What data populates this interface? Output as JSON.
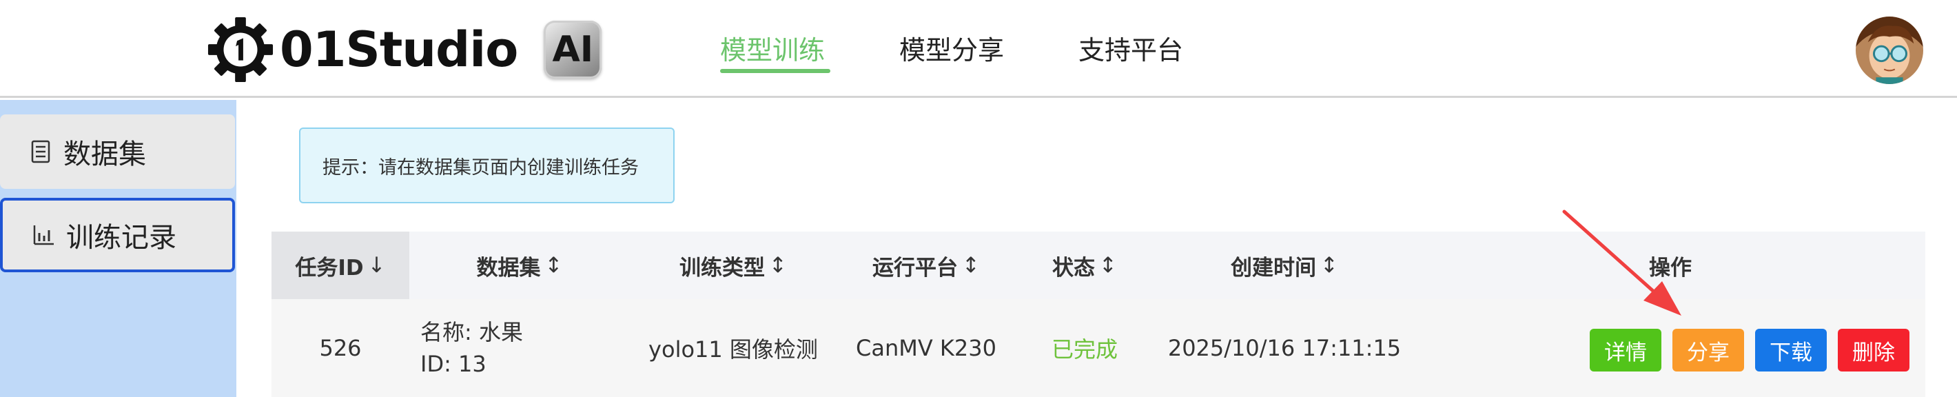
{
  "header": {
    "brand": "01Studio",
    "ai_badge": "AI",
    "nav": [
      {
        "label": "模型训练",
        "active": true
      },
      {
        "label": "模型分享",
        "active": false
      },
      {
        "label": "支持平台",
        "active": false
      }
    ],
    "accent_color": "#6cc46c"
  },
  "sidebar": {
    "items": [
      {
        "label": "数据集",
        "icon": "document-list-icon",
        "active": false
      },
      {
        "label": "训练记录",
        "icon": "bar-chart-icon",
        "active": true
      }
    ]
  },
  "tip": {
    "text": "提示：请在数据集页面内创建训练任务"
  },
  "table": {
    "headers": [
      {
        "label": "任务ID",
        "sort": "↓"
      },
      {
        "label": "数据集",
        "sort": "↕"
      },
      {
        "label": "训练类型",
        "sort": "↕"
      },
      {
        "label": "运行平台",
        "sort": "↕"
      },
      {
        "label": "状态",
        "sort": "↕"
      },
      {
        "label": "创建时间",
        "sort": "↕"
      },
      {
        "label": "操作",
        "sort": ""
      }
    ],
    "rows": [
      {
        "task_id": "526",
        "dataset_name": "名称: 水果",
        "dataset_id": "ID: 13",
        "train_type": "yolo11 图像检测",
        "platform": "CanMV K230",
        "status": "已完成",
        "created": "2025/10/16 17:11:15",
        "actions": {
          "detail": "详情",
          "share": "分享",
          "download": "下载",
          "delete": "删除"
        }
      }
    ]
  }
}
